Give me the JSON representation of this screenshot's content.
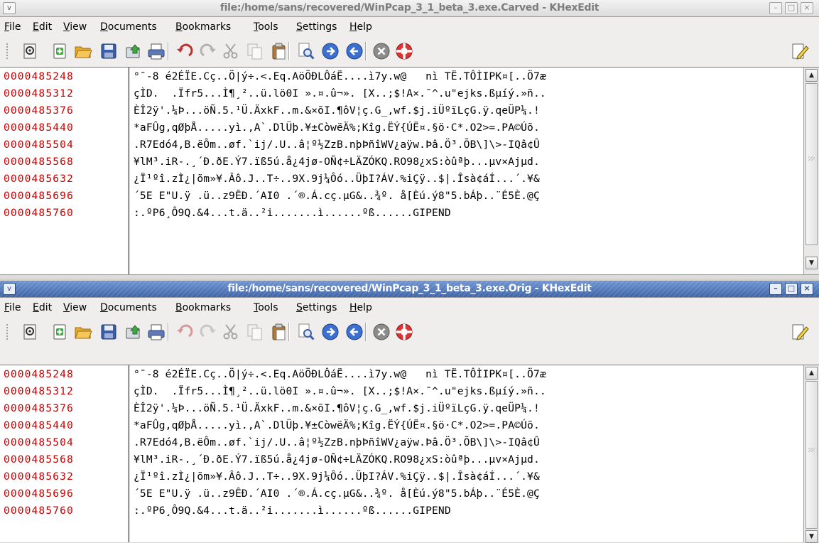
{
  "windows": [
    {
      "title": "file:/home/sans/recovered/WinPcap_3_1_beta_3.exe.Carved - KHexEdit",
      "state": "inactive"
    },
    {
      "title": "file:/home/sans/recovered/WinPcap_3_1_beta_3.exe.Orig - KHexEdit",
      "state": "active"
    }
  ],
  "menu": [
    "File",
    "Edit",
    "View",
    "Documents",
    "Bookmarks",
    "Tools",
    "Settings",
    "Help"
  ],
  "toolbar_icons": [
    "properties-icon",
    "new-document-icon",
    "open-folder-icon",
    "save-icon",
    "export-icon",
    "print-icon",
    "undo-icon",
    "redo-icon",
    "cut-icon",
    "copy-icon",
    "paste-icon",
    "find-icon",
    "forward-icon",
    "back-icon",
    "stop-icon",
    "help-icon",
    "edit-pencil-icon"
  ],
  "window_buttons": {
    "minimize": "–",
    "maximize": "□",
    "close": "×",
    "menu": "v"
  },
  "hex": {
    "offsets": [
      "0000485248",
      "0000485312",
      "0000485376",
      "0000485440",
      "0000485504",
      "0000485568",
      "0000485632",
      "0000485696",
      "0000485760"
    ],
    "text_rows": [
      "°¯-8 é2ÉÏE.Cç..Ö|ý÷.<.Eq.AöÖÐLÔáË....ì7y.w@   nì TË.TÔÌIPK¤[..Ö7æ",
      "çÌD.  .Ïfr5...Ì¶¸²..ü.lö0I ».¤.û¬». [X..;$!A×.¯^.u\"ejks.ßµíý.»ñ..",
      "ÈÎ2ÿ'.¼Þ...öÑ.5.¹Ü.ÄxkF..m.&×õI.¶ôV¦ç.G_,wf.$j.iÜºïLçG.ÿ.qeÜP¼.!",
      "*aFÛg,qØþÅ.....yì.,A`.DlÜþ.¥±CòwëÄ%;Kîg.ËÝ{ÚË¤.§ö·C*.O2>=.PA©Úõ.",
      ".R7Edó4,B.ëÔm..øf.`ij/.U..â¦º½ZzB.nþÞñîWV¿aÿw.Þâ.Ö³.ÕB\\]\\>-IQâ¢Û",
      "¥lM³.iR-.¸´Ð.ðE.Ý7.ïß5ú.å¿4jø-OÑ¢÷LÄZÓKQ.RO98¿xS:òûªþ...µv×Ajµd.",
      "¿Ï¹ºî.zÌ¿|õm»¥.Âô.J..T÷..9X.9j¼Ôó..ÜþI?ÁV.%iÇÿ..$|.Îsà¢áÍ...´.¥&",
      "´5E E\"U.ÿ .ü..z9ÊÐ.´AI0 .´®.Á.cç.µG&..¾º. å[Èú.ý8\"5.bÁþ..¨É5È.@Ç",
      ":.ºP6¸Ô9Q.&4...t.ä..²i.......ì......ºß......GIPEND"
    ]
  }
}
